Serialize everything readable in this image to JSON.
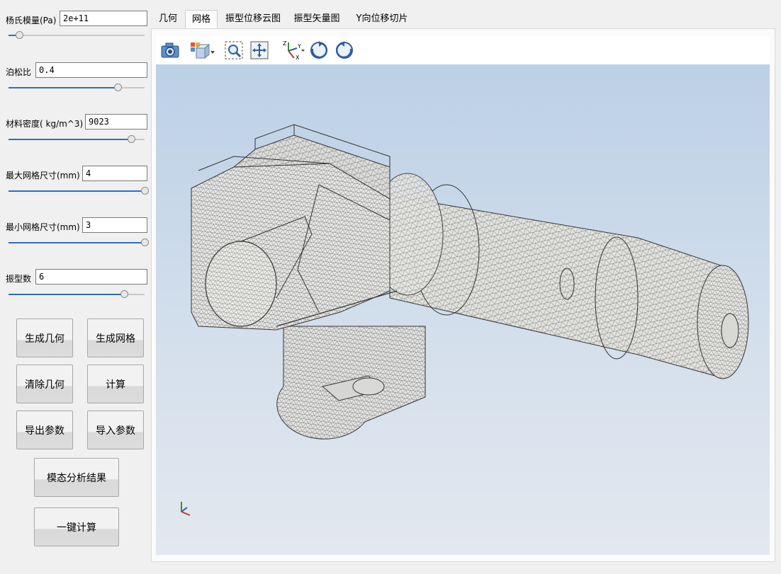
{
  "params": [
    {
      "label": "杨氏模量(Pa)",
      "value": "2e+11",
      "slider": 0.08
    },
    {
      "label": "泊松比",
      "value": "0.4",
      "slider": 0.8
    },
    {
      "label": "材料密度( kg/m^3)",
      "value": "9023",
      "slider": 0.9
    },
    {
      "label": "最大网格尺寸(mm)",
      "value": "4",
      "slider": 1.0
    },
    {
      "label": "最小网格尺寸(mm)",
      "value": "3",
      "slider": 1.0
    },
    {
      "label": "振型数",
      "value": "6",
      "slider": 0.85
    }
  ],
  "buttons": {
    "gen_geometry": "生成几何",
    "gen_mesh": "生成网格",
    "clear_geometry": "清除几何",
    "compute": "计算",
    "export_params": "导出参数",
    "import_params": "导入参数",
    "modal_results": "模态分析结果",
    "one_click": "一键计算"
  },
  "tabs": [
    {
      "label": "几何"
    },
    {
      "label": "网格",
      "active": true
    },
    {
      "label": "振型位移云图"
    },
    {
      "label": "振型矢量图"
    },
    {
      "label": "Y向位移切片"
    }
  ],
  "toolbar": {
    "icons": [
      "camera-icon",
      "view-cube-icon",
      "zoom-box-icon",
      "fit-view-icon",
      "axes-orientation-icon",
      "rotate-cw-icon",
      "rotate-ccw-icon"
    ],
    "axis_letters": [
      "Z",
      "Y",
      "X"
    ]
  },
  "colors": {
    "slider_fill": "#2f6fc0",
    "viewport_top": "#bcd0e6",
    "viewport_bottom": "#e3e8ef",
    "mesh_line": "#4a4a4a"
  }
}
